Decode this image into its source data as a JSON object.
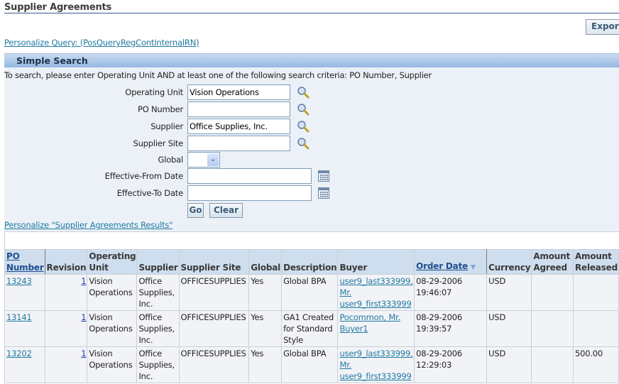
{
  "page": {
    "title": "Supplier Agreements",
    "export_label": "Export",
    "personalize_query_link": "Personalize Query: (PosQueryRegContInternalRN)"
  },
  "search": {
    "header": "Simple Search",
    "instructions": "To search, please enter Operating Unit AND at least one of the following search criteria: PO Number, Supplier",
    "fields": {
      "operating_unit": {
        "label": "Operating Unit",
        "value": "Vision Operations"
      },
      "po_number": {
        "label": "PO Number",
        "value": ""
      },
      "supplier": {
        "label": "Supplier",
        "value": "Office Supplies, Inc."
      },
      "supplier_site": {
        "label": "Supplier Site",
        "value": ""
      },
      "global": {
        "label": "Global",
        "value": ""
      },
      "effective_from": {
        "label": "Effective-From Date",
        "value": ""
      },
      "effective_to": {
        "label": "Effective-To Date",
        "value": ""
      }
    },
    "go_label": "Go",
    "clear_label": "Clear"
  },
  "results": {
    "personalize_link": "Personalize \"Supplier Agreements Results\"",
    "columns": {
      "po_number": "PO Number",
      "revision": "Revision",
      "operating_unit": "Operating Unit",
      "supplier": "Supplier",
      "supplier_site": "Supplier Site",
      "global": "Global",
      "description": "Description",
      "buyer": "Buyer",
      "order_date": "Order Date",
      "currency": "Currency",
      "amount_agreed": "Amount Agreed",
      "amount_released": "Amount Released"
    },
    "sort_indicator": "descending",
    "rows": [
      {
        "po_number": "13243",
        "revision": "1",
        "operating_unit": "Vision Operations",
        "supplier": "Office Supplies, Inc.",
        "supplier_site": "OFFICESUPPLIES",
        "global": "Yes",
        "description": "Global BPA",
        "buyer": "user9_last333999, Mr. user9_first333999",
        "order_date": "08-29-2006 19:46:07",
        "currency": "USD",
        "amount_agreed": "",
        "amount_released": ""
      },
      {
        "po_number": "13141",
        "revision": "1",
        "operating_unit": "Vision Operations",
        "supplier": "Office Supplies, Inc.",
        "supplier_site": "OFFICESUPPLIES",
        "global": "Yes",
        "description": "GA1 Created for Standard Style",
        "buyer": "Pocommon, Mr. Buyer1",
        "order_date": "08-29-2006 19:39:57",
        "currency": "USD",
        "amount_agreed": "",
        "amount_released": ""
      },
      {
        "po_number": "13202",
        "revision": "1",
        "operating_unit": "Vision Operations",
        "supplier": "Office Supplies, Inc.",
        "supplier_site": "OFFICESUPPLIES",
        "global": "Yes",
        "description": "Global BPA",
        "buyer": "user9_last333999, Mr. user9_first333999",
        "order_date": "08-29-2006 12:29:03",
        "currency": "USD",
        "amount_agreed": "",
        "amount_released": "500.00"
      }
    ]
  }
}
